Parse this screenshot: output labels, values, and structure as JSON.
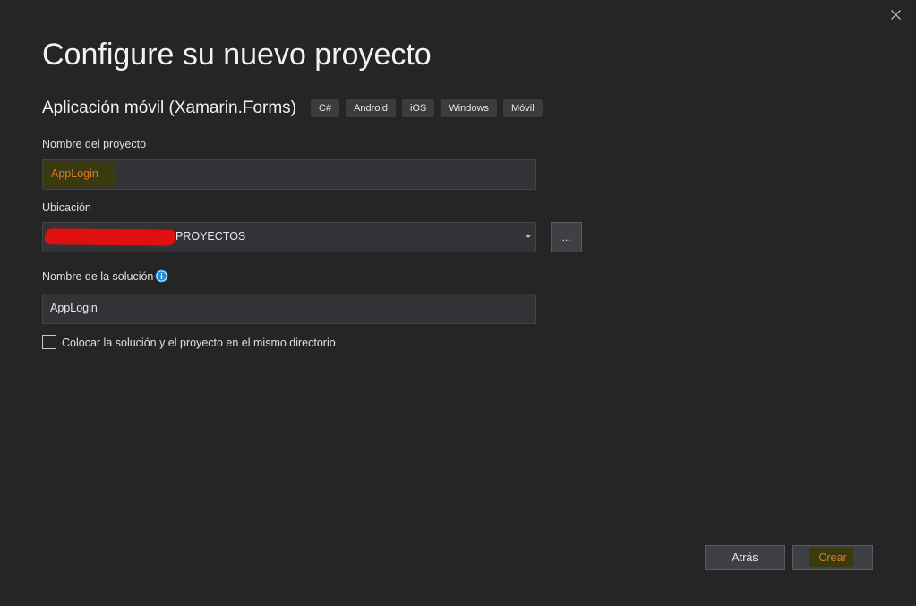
{
  "dialog": {
    "title": "Configure su nuevo proyecto",
    "close_icon": "close-icon"
  },
  "template": {
    "name": "Aplicación móvil (Xamarin.Forms)",
    "tags": [
      "C#",
      "Android",
      "iOS",
      "Windows",
      "Móvil"
    ]
  },
  "project_name": {
    "label": "Nombre del proyecto",
    "value": "AppLogin"
  },
  "location": {
    "label": "Ubicación",
    "value_visible": "PROYECTOS",
    "browse_label": "..."
  },
  "solution_name": {
    "label": "Nombre de la solución",
    "info_icon": "info-icon",
    "value": "AppLogin"
  },
  "same_directory": {
    "label": "Colocar la solución y el proyecto en el mismo directorio",
    "checked": false
  },
  "footer": {
    "back_label": "Atrás",
    "create_label": "Crear"
  },
  "colors": {
    "background": "#252526",
    "field_background": "#333337",
    "highlight_text": "#d97a2a",
    "info_icon": "#1e8ad6",
    "redaction": "#e01010"
  }
}
